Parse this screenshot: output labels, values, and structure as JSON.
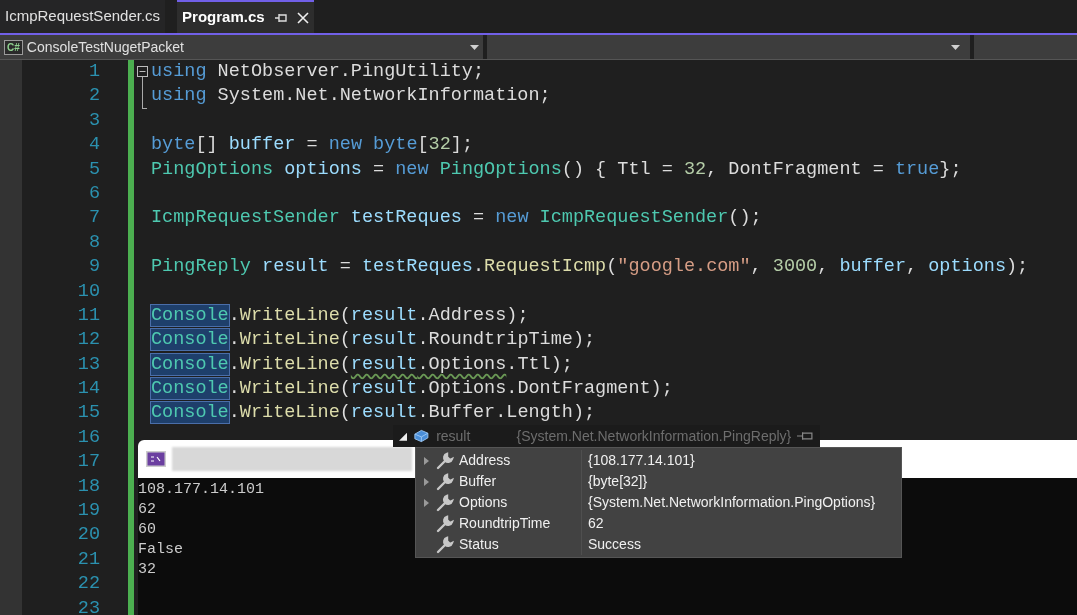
{
  "tabs": [
    {
      "label": "IcmpRequestSender.cs",
      "selected": false
    },
    {
      "label": "Program.cs",
      "selected": true
    }
  ],
  "navigation": {
    "project_icon_text": "C#",
    "project": "ConsoleTestNugetPacket"
  },
  "editor": {
    "lines": [
      {
        "number": "1",
        "tokens": [
          {
            "text": "using",
            "kind": "keyword"
          },
          {
            "text": " NetObserver.PingUtility;",
            "kind": "plain"
          }
        ]
      },
      {
        "number": "2",
        "tokens": [
          {
            "text": "using",
            "kind": "keyword"
          },
          {
            "text": " System.Net.NetworkInformation;",
            "kind": "plain"
          }
        ]
      },
      {
        "number": "3"
      },
      {
        "number": "4",
        "tokens": [
          {
            "text": "byte",
            "kind": "keyword"
          },
          {
            "text": "[] ",
            "kind": "plain"
          },
          {
            "text": "buffer",
            "kind": "variable"
          },
          {
            "text": " = ",
            "kind": "plain"
          },
          {
            "text": "new byte",
            "kind": "keyword"
          },
          {
            "text": "[",
            "kind": "plain"
          },
          {
            "text": "32",
            "kind": "number"
          },
          {
            "text": "];",
            "kind": "plain"
          }
        ]
      },
      {
        "number": "5",
        "tokens": [
          {
            "text": "PingOptions",
            "kind": "type"
          },
          {
            "text": " options",
            "kind": "variable"
          },
          {
            "text": " = ",
            "kind": "plain"
          },
          {
            "text": "new",
            "kind": "keyword"
          },
          {
            "text": " PingOptions",
            "kind": "type"
          },
          {
            "text": "() { Ttl = ",
            "kind": "plain"
          },
          {
            "text": "32",
            "kind": "number"
          },
          {
            "text": ", DontFragment = ",
            "kind": "plain"
          },
          {
            "text": "true",
            "kind": "keyword"
          },
          {
            "text": "};",
            "kind": "plain"
          }
        ]
      },
      {
        "number": "6"
      },
      {
        "number": "7",
        "tokens": [
          {
            "text": "IcmpRequestSender",
            "kind": "type"
          },
          {
            "text": " testReques",
            "kind": "variable"
          },
          {
            "text": " = ",
            "kind": "plain"
          },
          {
            "text": "new",
            "kind": "keyword"
          },
          {
            "text": " IcmpRequestSender",
            "kind": "type"
          },
          {
            "text": "();",
            "kind": "plain"
          }
        ]
      },
      {
        "number": "8"
      },
      {
        "number": "9",
        "tokens": [
          {
            "text": "PingReply",
            "kind": "type"
          },
          {
            "text": " result",
            "kind": "variable"
          },
          {
            "text": " = ",
            "kind": "plain"
          },
          {
            "text": "testReques",
            "kind": "variable"
          },
          {
            "text": ".",
            "kind": "plain"
          },
          {
            "text": "RequestIcmp",
            "kind": "method"
          },
          {
            "text": "(",
            "kind": "plain"
          },
          {
            "text": "\"google.com\"",
            "kind": "string"
          },
          {
            "text": ", ",
            "kind": "plain"
          },
          {
            "text": "3000",
            "kind": "number"
          },
          {
            "text": ", ",
            "kind": "plain"
          },
          {
            "text": "buffer",
            "kind": "variable"
          },
          {
            "text": ", ",
            "kind": "plain"
          },
          {
            "text": "options",
            "kind": "variable"
          },
          {
            "text": ");",
            "kind": "plain"
          }
        ]
      },
      {
        "number": "10"
      },
      {
        "number": "11",
        "tokens": [
          {
            "text": "Console",
            "kind": "highlighted-type"
          },
          {
            "text": ".",
            "kind": "plain"
          },
          {
            "text": "WriteLine",
            "kind": "method"
          },
          {
            "text": "(",
            "kind": "plain"
          },
          {
            "text": "result",
            "kind": "variable"
          },
          {
            "text": ".Address);",
            "kind": "plain"
          }
        ]
      },
      {
        "number": "12",
        "tokens": [
          {
            "text": "Console",
            "kind": "highlighted-type"
          },
          {
            "text": ".",
            "kind": "plain"
          },
          {
            "text": "WriteLine",
            "kind": "method"
          },
          {
            "text": "(",
            "kind": "plain"
          },
          {
            "text": "result",
            "kind": "variable"
          },
          {
            "text": ".RoundtripTime);",
            "kind": "plain"
          }
        ]
      },
      {
        "number": "13",
        "tokens": [
          {
            "text": "Console",
            "kind": "highlighted-type"
          },
          {
            "text": ".",
            "kind": "plain"
          },
          {
            "text": "WriteLine",
            "kind": "method"
          },
          {
            "text": "(",
            "kind": "plain"
          },
          {
            "text": "result",
            "kind": "variable",
            "squiggle": true
          },
          {
            "text": ".Options",
            "kind": "plain",
            "squiggle": true
          },
          {
            "text": ".Ttl);",
            "kind": "plain"
          }
        ]
      },
      {
        "number": "14",
        "tokens": [
          {
            "text": "Console",
            "kind": "highlighted-type"
          },
          {
            "text": ".",
            "kind": "plain"
          },
          {
            "text": "WriteLine",
            "kind": "method"
          },
          {
            "text": "(",
            "kind": "plain"
          },
          {
            "text": "result",
            "kind": "variable"
          },
          {
            "text": ".Options.DontFragment);",
            "kind": "plain"
          }
        ]
      },
      {
        "number": "15",
        "tokens": [
          {
            "text": "Console",
            "kind": "highlighted-type"
          },
          {
            "text": ".",
            "kind": "plain"
          },
          {
            "text": "WriteLine",
            "kind": "method"
          },
          {
            "text": "(",
            "kind": "plain"
          },
          {
            "text": "result",
            "kind": "variable"
          },
          {
            "text": ".Buffer.Length);",
            "kind": "plain"
          }
        ]
      },
      {
        "number": "16"
      },
      {
        "number": "17"
      },
      {
        "number": "18"
      },
      {
        "number": "19"
      },
      {
        "number": "20"
      },
      {
        "number": "21"
      },
      {
        "number": "22"
      },
      {
        "number": "23"
      }
    ]
  },
  "console": {
    "output": [
      "108.177.14.101",
      "62",
      "60",
      "False",
      "32"
    ]
  },
  "datatip": {
    "name": "result",
    "type": "{System.Net.NetworkInformation.PingReply}",
    "rows": [
      {
        "name": "Address",
        "value": "{108.177.14.101}",
        "expandable": true
      },
      {
        "name": "Buffer",
        "value": "{byte[32]}",
        "expandable": true
      },
      {
        "name": "Options",
        "value": "{System.Net.NetworkInformation.PingOptions}",
        "expandable": true
      },
      {
        "name": "RoundtripTime",
        "value": "62",
        "expandable": false
      },
      {
        "name": "Status",
        "value": "Success",
        "expandable": false
      }
    ]
  }
}
